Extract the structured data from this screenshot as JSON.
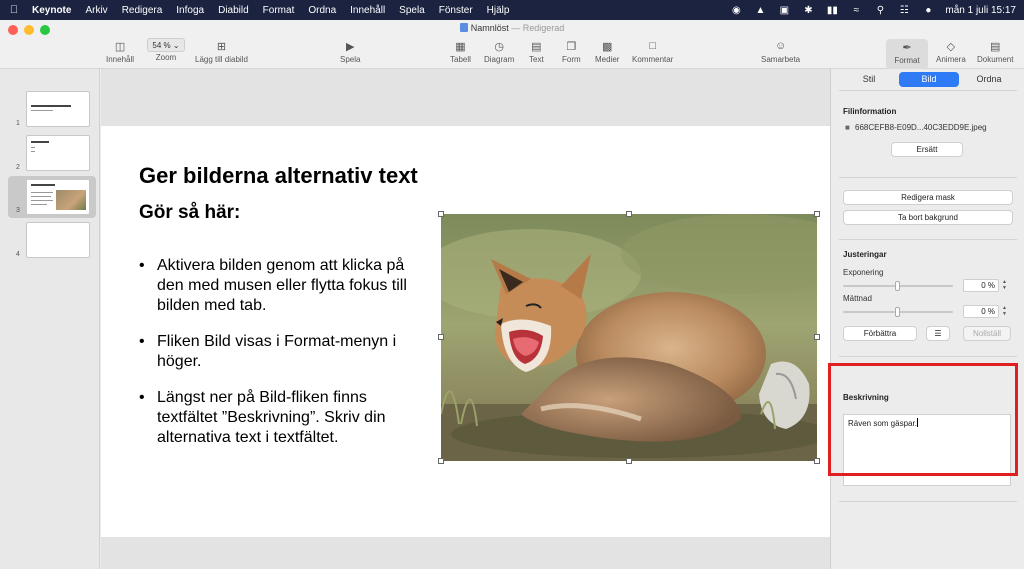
{
  "menubar": {
    "app": "Keynote",
    "items": [
      "Arkiv",
      "Redigera",
      "Infoga",
      "Diabild",
      "Format",
      "Ordna",
      "Innehåll",
      "Spela",
      "Fönster",
      "Hjälp"
    ],
    "clock": "mån 1 juli  15:17"
  },
  "window": {
    "title": "Namnlöst",
    "edited": "— Redigerad"
  },
  "toolbar": {
    "innehall": "Innehåll",
    "zoom_value": "54 %",
    "zoom": "Zoom",
    "add_slide": "Lägg till diabild",
    "play": "Spela",
    "table": "Tabell",
    "chart": "Diagram",
    "text": "Text",
    "shape": "Form",
    "media": "Medier",
    "comment": "Kommentar",
    "collaborate": "Samarbeta",
    "format": "Format",
    "animate": "Animera",
    "document": "Dokument"
  },
  "navigator": {
    "slides": [
      {
        "num": "1",
        "title": "Tillgängliga presentationer",
        "sub": "Med några länkar"
      },
      {
        "num": "2",
        "title": "Hur gör man?",
        "sub": ""
      },
      {
        "num": "3",
        "title": "Ger bilderna alternativ text",
        "sub": ""
      },
      {
        "num": "4",
        "title": "",
        "sub": ""
      }
    ]
  },
  "slide": {
    "title": "Ger bilderna alternativ text",
    "subtitle": "Gör så här:",
    "bullets": [
      "Aktivera bilden genom att klicka på den med musen eller flytta fokus till bilden med tab.",
      "Fliken Bild visas i Format-menyn i höger.",
      "Längst ner på Bild-fliken finns textfältet ”Beskrivning”. Skriv din alternativa text i textfältet."
    ]
  },
  "inspector": {
    "tabs": [
      "Stil",
      "Bild",
      "Ordna"
    ],
    "active_tab": "Bild",
    "file_info_heading": "Filinformation",
    "file_name": "668CEFB8-E09D...40C3EDD9E.jpeg",
    "replace": "Ersätt",
    "edit_mask": "Redigera mask",
    "remove_bg": "Ta bort bakgrund",
    "adjustments_heading": "Justeringar",
    "exposure_label": "Exponering",
    "exposure_value": "0 %",
    "saturation_label": "Mättnad",
    "saturation_value": "0 %",
    "enhance": "Förbättra",
    "reset": "Nollställ",
    "description_heading": "Beskrivning",
    "description_value": "Räven som gäspar."
  },
  "colors": {
    "accent": "#2f7bf5",
    "highlight": "#e02020",
    "menubar": "#1b2340"
  }
}
